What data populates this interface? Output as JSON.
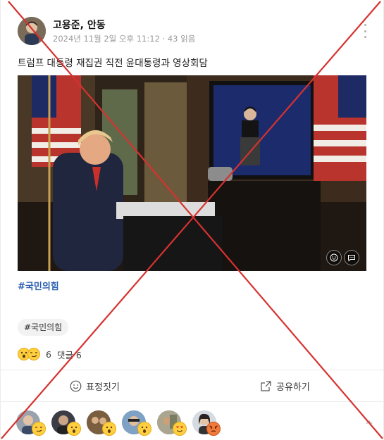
{
  "post": {
    "author": "고용준, 안동",
    "meta": "2024년 11월 2일 오후 11:12 · 43 읽음",
    "text": "트럼프 대통령 재집권 직전 윤대통령과 영상회담",
    "hashtag": "#국민의힘",
    "tag_chip": "#국민의힘"
  },
  "stats": {
    "reaction_count": "6",
    "comments": "댓글 6"
  },
  "actions": {
    "react": "표정짓기",
    "share": "공유하기"
  },
  "reactors": [
    {
      "icon": "smirk-emoji"
    },
    {
      "icon": "surprised-emoji"
    },
    {
      "icon": "surprised-emoji"
    },
    {
      "icon": "surprised-emoji"
    },
    {
      "icon": "heart-eyes-emoji"
    },
    {
      "icon": "angry-emoji"
    }
  ],
  "colors": {
    "hashtag": "#2a5db0",
    "overlay_x": "#d6322f",
    "emoji": "#ffcf3f"
  }
}
